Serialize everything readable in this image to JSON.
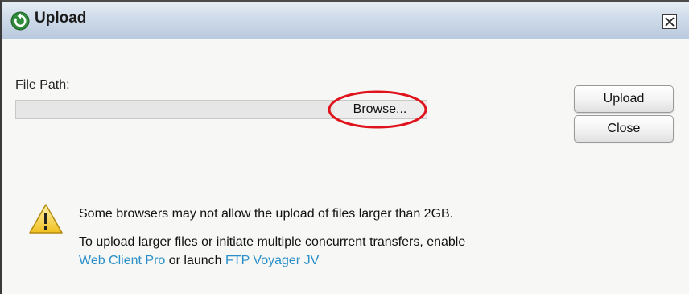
{
  "dialog": {
    "title": "Upload",
    "close_icon": "close-x-icon",
    "app_icon": "app-logo-icon"
  },
  "form": {
    "file_path_label": "File Path:",
    "file_path_value": "",
    "browse_label": "Browse..."
  },
  "actions": {
    "upload_label": "Upload",
    "close_label": "Close"
  },
  "notice": {
    "icon": "warning-icon",
    "line1": "Some browsers may not allow the upload of files larger than 2GB.",
    "line2": "To upload larger files or initiate multiple concurrent transfers, enable",
    "link1": "Web Client Pro",
    "middle": " or launch ",
    "link2": "FTP Voyager JV"
  },
  "colors": {
    "link": "#2a8fc9",
    "highlight_ellipse": "#e0141c",
    "titlebar": "#cfdbe9"
  }
}
